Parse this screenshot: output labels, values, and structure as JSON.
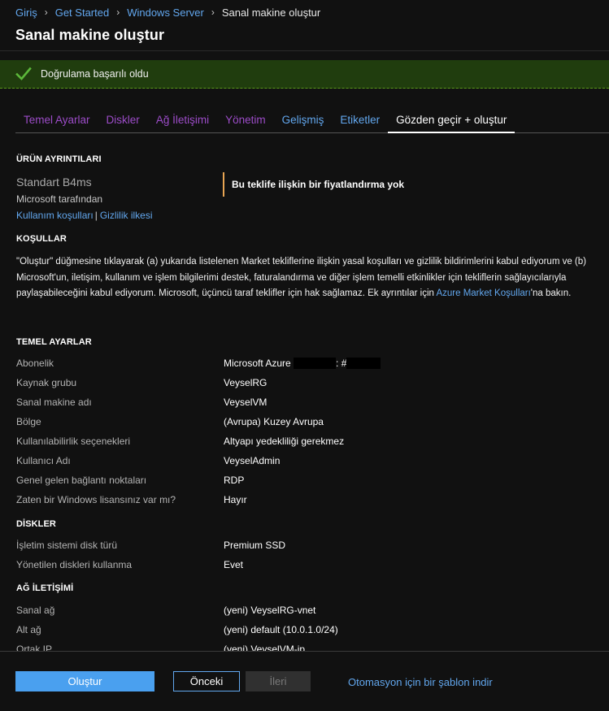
{
  "breadcrumb": {
    "items": [
      "Giriş",
      "Get Started",
      "Windows Server"
    ],
    "current": "Sanal makine oluştur"
  },
  "page_title": "Sanal makine oluştur",
  "banner": {
    "icon": "checkmark-icon",
    "message": "Doğrulama başarılı oldu",
    "color": "#5cb83a"
  },
  "tabs": [
    {
      "label": "Temel Ayarlar",
      "state": "visited"
    },
    {
      "label": "Diskler",
      "state": "visited"
    },
    {
      "label": "Ağ İletişimi",
      "state": "visited"
    },
    {
      "label": "Yönetim",
      "state": "visited"
    },
    {
      "label": "Gelişmiş",
      "state": "link"
    },
    {
      "label": "Etiketler",
      "state": "link"
    },
    {
      "label": "Gözden geçir + oluştur",
      "state": "active"
    }
  ],
  "product": {
    "heading": "ÜRÜN AYRINTILARI",
    "name": "Standart B4ms",
    "publisher": "Microsoft tarafından",
    "terms_link": "Kullanım koşulları",
    "separator": "|",
    "privacy_link": "Gizlilik ilkesi",
    "pricing": "Bu teklife ilişkin bir fiyatlandırma yok"
  },
  "terms": {
    "heading": "KOŞULLAR",
    "text": "\"Oluştur\" düğmesine tıklayarak (a) yukarıda listelenen Market tekliflerine ilişkin yasal koşulları ve gizlilik bildirimlerini kabul ediyorum ve (b) Microsoft'un, iletişim, kullanım ve işlem bilgilerimi destek, faturalandırma ve diğer işlem temelli etkinlikler için tekliflerin sağlayıcılarıyla paylaşabileceğini kabul ediyorum. Microsoft, üçüncü taraf teklifler için hak sağlamaz. Ek ayrıntılar için ",
    "link": "Azure Market Koşulları",
    "suffix": "'na bakın."
  },
  "basics": {
    "heading": "TEMEL AYARLAR",
    "subscription_label": "Abonelik",
    "subscription_value": "Microsoft Azure",
    "subscription_mid": ": #",
    "rows": [
      {
        "label": "Kaynak grubu",
        "value": "VeyselRG"
      },
      {
        "label": "Sanal makine adı",
        "value": "VeyselVM"
      },
      {
        "label": "Bölge",
        "value": "(Avrupa) Kuzey Avrupa"
      },
      {
        "label": "Kullanılabilirlik seçenekleri",
        "value": "Altyapı yedekliliği gerekmez"
      },
      {
        "label": "Kullanıcı Adı",
        "value": "VeyselAdmin"
      },
      {
        "label": "Genel gelen bağlantı noktaları",
        "value": "RDP"
      },
      {
        "label": "Zaten bir Windows lisansınız var mı?",
        "value": "Hayır"
      }
    ]
  },
  "disks": {
    "heading": "DİSKLER",
    "rows": [
      {
        "label": "İşletim sistemi disk türü",
        "value": "Premium SSD"
      },
      {
        "label": "Yönetilen diskleri kullanma",
        "value": "Evet"
      }
    ]
  },
  "network": {
    "heading": "AĞ İLETİŞİMİ",
    "rows": [
      {
        "label": "Sanal ağ",
        "value": "(yeni) VeyselRG-vnet"
      },
      {
        "label": "Alt ağ",
        "value": "(yeni) default (10.0.1.0/24)"
      },
      {
        "label": "Ortak IP",
        "value": "(yeni) VeyselVM-ip"
      }
    ]
  },
  "footer": {
    "create": "Oluştur",
    "previous": "Önceki",
    "next": "İleri",
    "template_link": "Otomasyon için bir şablon indir"
  }
}
